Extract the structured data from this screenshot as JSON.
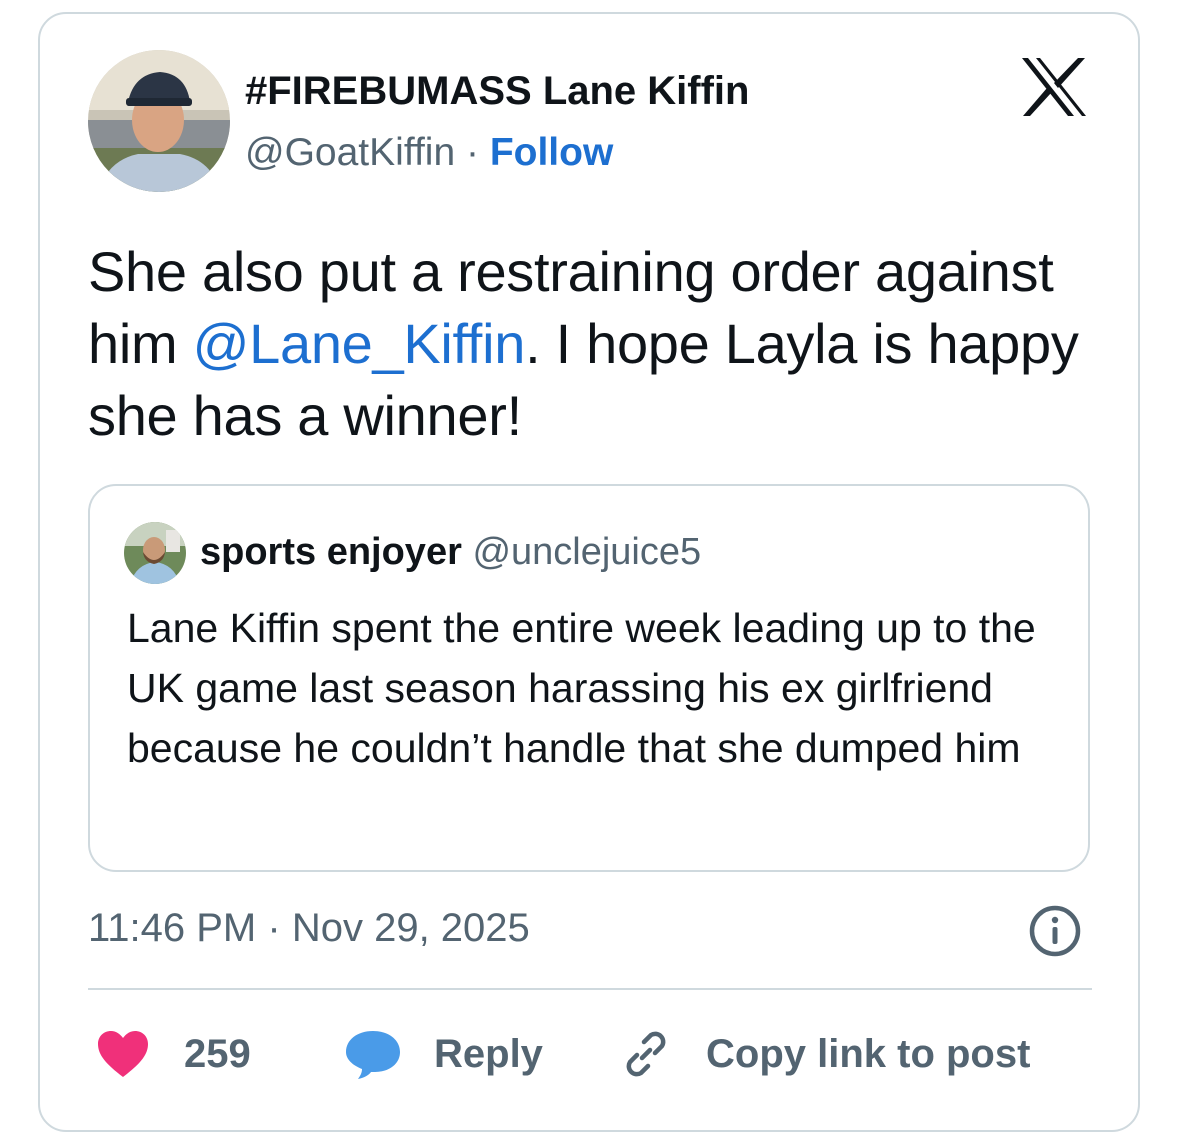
{
  "author": {
    "display_name": "#FIREBUMASS Lane Kiffin",
    "handle": "@GoatKiffin",
    "separator": "·",
    "follow_label": "Follow"
  },
  "tweet": {
    "text_part1": "She also put a restraining order against him ",
    "mention": "@Lane_Kiffin",
    "text_part2": ". I hope Layla is happy she has a winner!"
  },
  "quoted_tweet": {
    "display_name": "sports enjoyer",
    "handle": "@unclejuice5",
    "text": "Lane Kiffin spent the entire week leading up to the UK game last season harassing his ex girlfriend because he couldn’t handle that she dumped him"
  },
  "meta": {
    "time": "11:46 PM",
    "separator": "·",
    "date": "Nov 29, 2025"
  },
  "actions": {
    "like_count": "259",
    "reply_label": "Reply",
    "copy_link_label": "Copy link to post"
  },
  "colors": {
    "accent": "#1d6fd0",
    "like": "#f0307a",
    "reply_bubble": "#4a9be8",
    "muted_text": "#536471",
    "border": "#cfd9de"
  },
  "icons": [
    "x-logo-icon",
    "info-icon",
    "heart-icon",
    "reply-bubble-icon",
    "link-icon"
  ]
}
